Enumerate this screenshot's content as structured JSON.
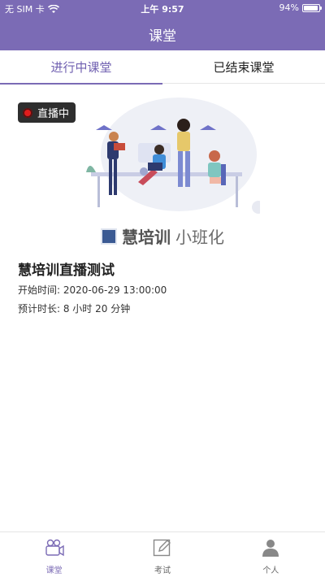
{
  "status_bar": {
    "carrier": "无 SIM 卡",
    "time": "上午 9:57",
    "battery_text": "94%",
    "battery_level": 0.94
  },
  "header": {
    "title": "课堂"
  },
  "tabs": [
    {
      "label": "进行中课堂",
      "active": true
    },
    {
      "label": "已结束课堂",
      "active": false
    }
  ],
  "course": {
    "badge": "直播中",
    "brand_bold": "慧培训",
    "brand_light": "小班化",
    "title": "慧培训直播测试",
    "start_label": "开始时间: 2020-06-29 13:00:00",
    "duration_label": "预计时长: 8 小时 20 分钟"
  },
  "bottom_nav": [
    {
      "label": "课堂",
      "icon": "video-camera-icon",
      "active": true
    },
    {
      "label": "考试",
      "icon": "edit-icon",
      "active": false
    },
    {
      "label": "个人",
      "icon": "person-icon",
      "active": false
    }
  ],
  "colors": {
    "accent": "#7b6bb5",
    "live": "#e11d1d"
  }
}
